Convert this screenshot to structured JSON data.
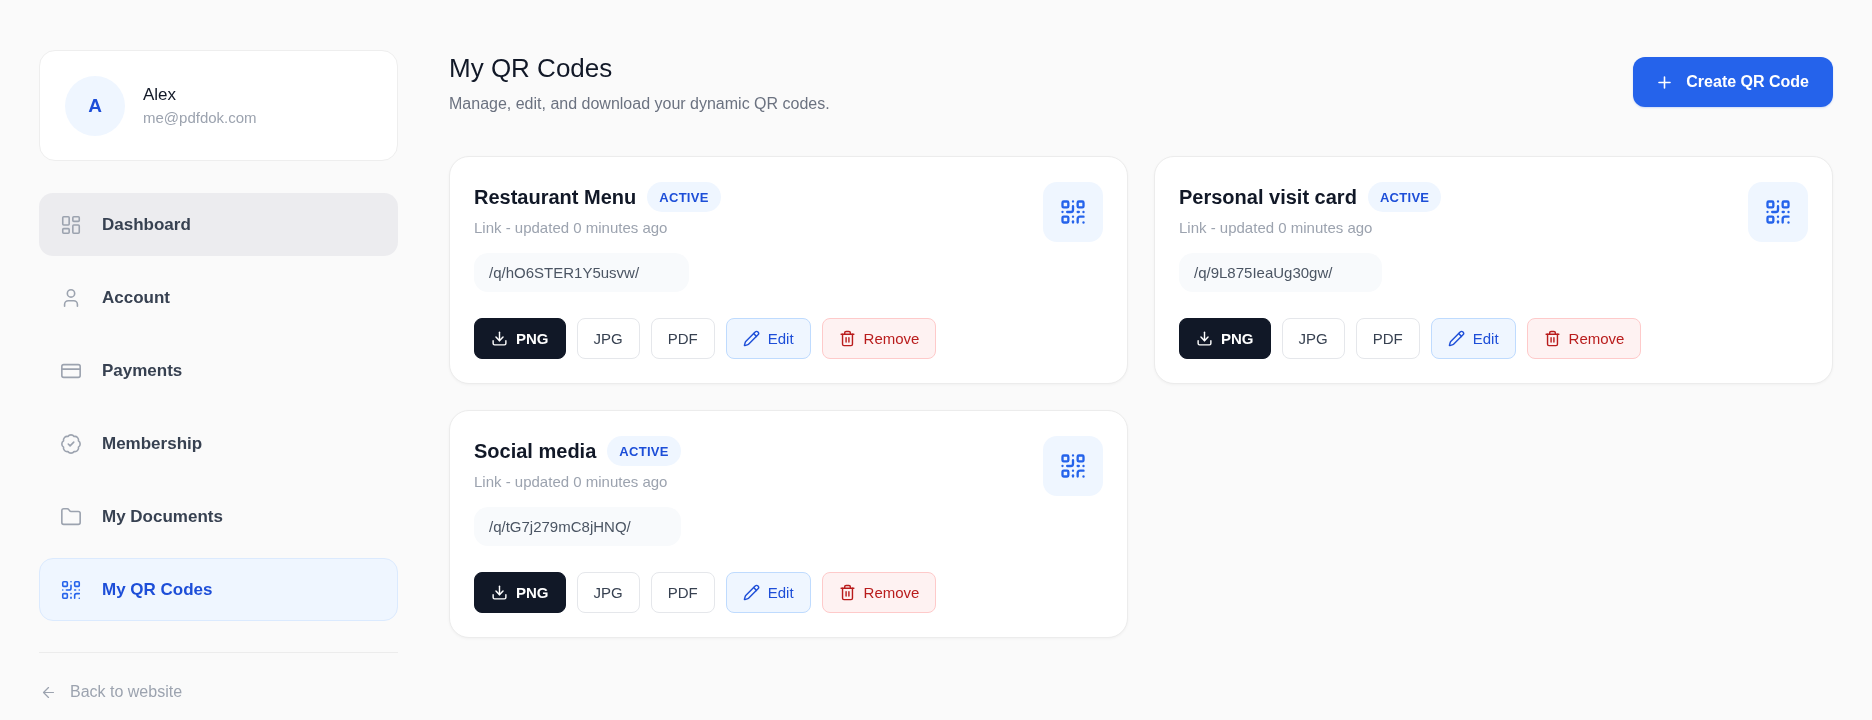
{
  "profile": {
    "initial": "A",
    "name": "Alex",
    "email": "me@pdfdok.com"
  },
  "nav": [
    {
      "label": "Dashboard",
      "selected": false,
      "hovered": true
    },
    {
      "label": "Account",
      "selected": false,
      "hovered": false
    },
    {
      "label": "Payments",
      "selected": false,
      "hovered": false
    },
    {
      "label": "Membership",
      "selected": false,
      "hovered": false
    },
    {
      "label": "My Documents",
      "selected": false,
      "hovered": false
    },
    {
      "label": "My QR Codes",
      "selected": true,
      "hovered": false
    }
  ],
  "back_link": "Back to website",
  "header": {
    "title": "My QR Codes",
    "subtitle": "Manage, edit, and download your dynamic QR codes."
  },
  "create_button": "Create QR Code",
  "qr_codes": [
    {
      "name": "Restaurant Menu",
      "status": "ACTIVE",
      "meta": "Link - updated 0 minutes ago",
      "path": "/q/hO6STER1Y5usvw/",
      "actions": [
        {
          "kind": "download",
          "label": "PNG"
        },
        {
          "kind": "format",
          "label": "JPG"
        },
        {
          "kind": "format",
          "label": "PDF"
        },
        {
          "kind": "edit",
          "label": "Edit"
        },
        {
          "kind": "remove",
          "label": "Remove"
        }
      ]
    },
    {
      "name": "Personal visit card",
      "status": "ACTIVE",
      "meta": "Link - updated 0 minutes ago",
      "path": "/q/9L875IeaUg30gw/",
      "actions": [
        {
          "kind": "download",
          "label": "PNG"
        },
        {
          "kind": "format",
          "label": "JPG"
        },
        {
          "kind": "format",
          "label": "PDF"
        },
        {
          "kind": "edit",
          "label": "Edit"
        },
        {
          "kind": "remove",
          "label": "Remove"
        }
      ]
    },
    {
      "name": "Social media",
      "status": "ACTIVE",
      "meta": "Link - updated 0 minutes ago",
      "path": "/q/tG7j279mC8jHNQ/",
      "actions": [
        {
          "kind": "download",
          "label": "PNG"
        },
        {
          "kind": "format",
          "label": "JPG"
        },
        {
          "kind": "format",
          "label": "PDF"
        },
        {
          "kind": "edit",
          "label": "Edit"
        },
        {
          "kind": "remove",
          "label": "Remove"
        }
      ]
    }
  ]
}
